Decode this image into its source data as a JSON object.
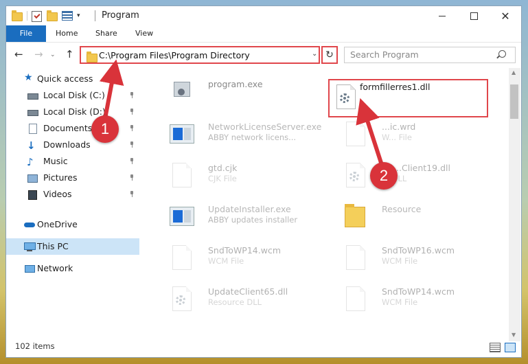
{
  "window": {
    "title": "Program"
  },
  "ribbon": {
    "tabs": [
      "File",
      "Home",
      "Share",
      "View"
    ],
    "help": "?"
  },
  "nav": {
    "back": "←",
    "forward": "→",
    "up": "↑",
    "recent": "⌄"
  },
  "address": {
    "path": "C:\\Program Files\\Program Directory",
    "dropdown": "⌄",
    "refresh": "↻"
  },
  "search": {
    "placeholder": "Search Program"
  },
  "sidebar": {
    "items": [
      {
        "label": "Quick access",
        "icon": "star-icon"
      },
      {
        "label": "Local Disk (C:)",
        "icon": "drive-icon",
        "pinned": true
      },
      {
        "label": "Local Disk (D:)",
        "icon": "drive-icon",
        "pinned": true
      },
      {
        "label": "Documents",
        "icon": "documents-icon",
        "pinned": true
      },
      {
        "label": "Downloads",
        "icon": "download-icon",
        "pinned": true
      },
      {
        "label": "Music",
        "icon": "music-icon",
        "pinned": true
      },
      {
        "label": "Pictures",
        "icon": "pictures-icon",
        "pinned": true
      },
      {
        "label": "Videos",
        "icon": "videos-icon",
        "pinned": true
      },
      {
        "label": "OneDrive",
        "icon": "cloud-icon"
      },
      {
        "label": "This PC",
        "icon": "pc-icon",
        "selected": true
      },
      {
        "label": "Network",
        "icon": "network-icon"
      }
    ]
  },
  "files": [
    {
      "name": "program.exe",
      "desc": "",
      "icon": "program-icon"
    },
    {
      "name": "formfillerres1.dll",
      "desc": "",
      "icon": "dll-icon",
      "highlighted": true
    },
    {
      "name": "NetworkLicenseServer.exe",
      "desc": "ABBY network licens...",
      "icon": "exe-icon"
    },
    {
      "name": "...ic.wrd",
      "desc": "W... File",
      "icon": "file-icon"
    },
    {
      "name": "gtd.cjk",
      "desc": "CJK File",
      "icon": "file-icon"
    },
    {
      "name": "Up...Client19.dll",
      "desc": "... DLL",
      "icon": "dll-icon"
    },
    {
      "name": "UpdateInstaller.exe",
      "desc": "ABBY updates installer",
      "icon": "exe-icon"
    },
    {
      "name": "Resource",
      "desc": "",
      "icon": "folder-icon"
    },
    {
      "name": "SndToWP14.wcm",
      "desc": "WCM File",
      "icon": "file-icon"
    },
    {
      "name": "SndToWP16.wcm",
      "desc": "WCM File",
      "icon": "file-icon"
    },
    {
      "name": "UpdateClient65.dll",
      "desc": "Resource DLL",
      "icon": "dll-icon"
    },
    {
      "name": "SndToWP14.wcm",
      "desc": "WCM File",
      "icon": "file-icon"
    }
  ],
  "annotations": {
    "step1": "1",
    "step2": "2",
    "color": "#d9333a"
  },
  "status": {
    "count": "102 items"
  }
}
